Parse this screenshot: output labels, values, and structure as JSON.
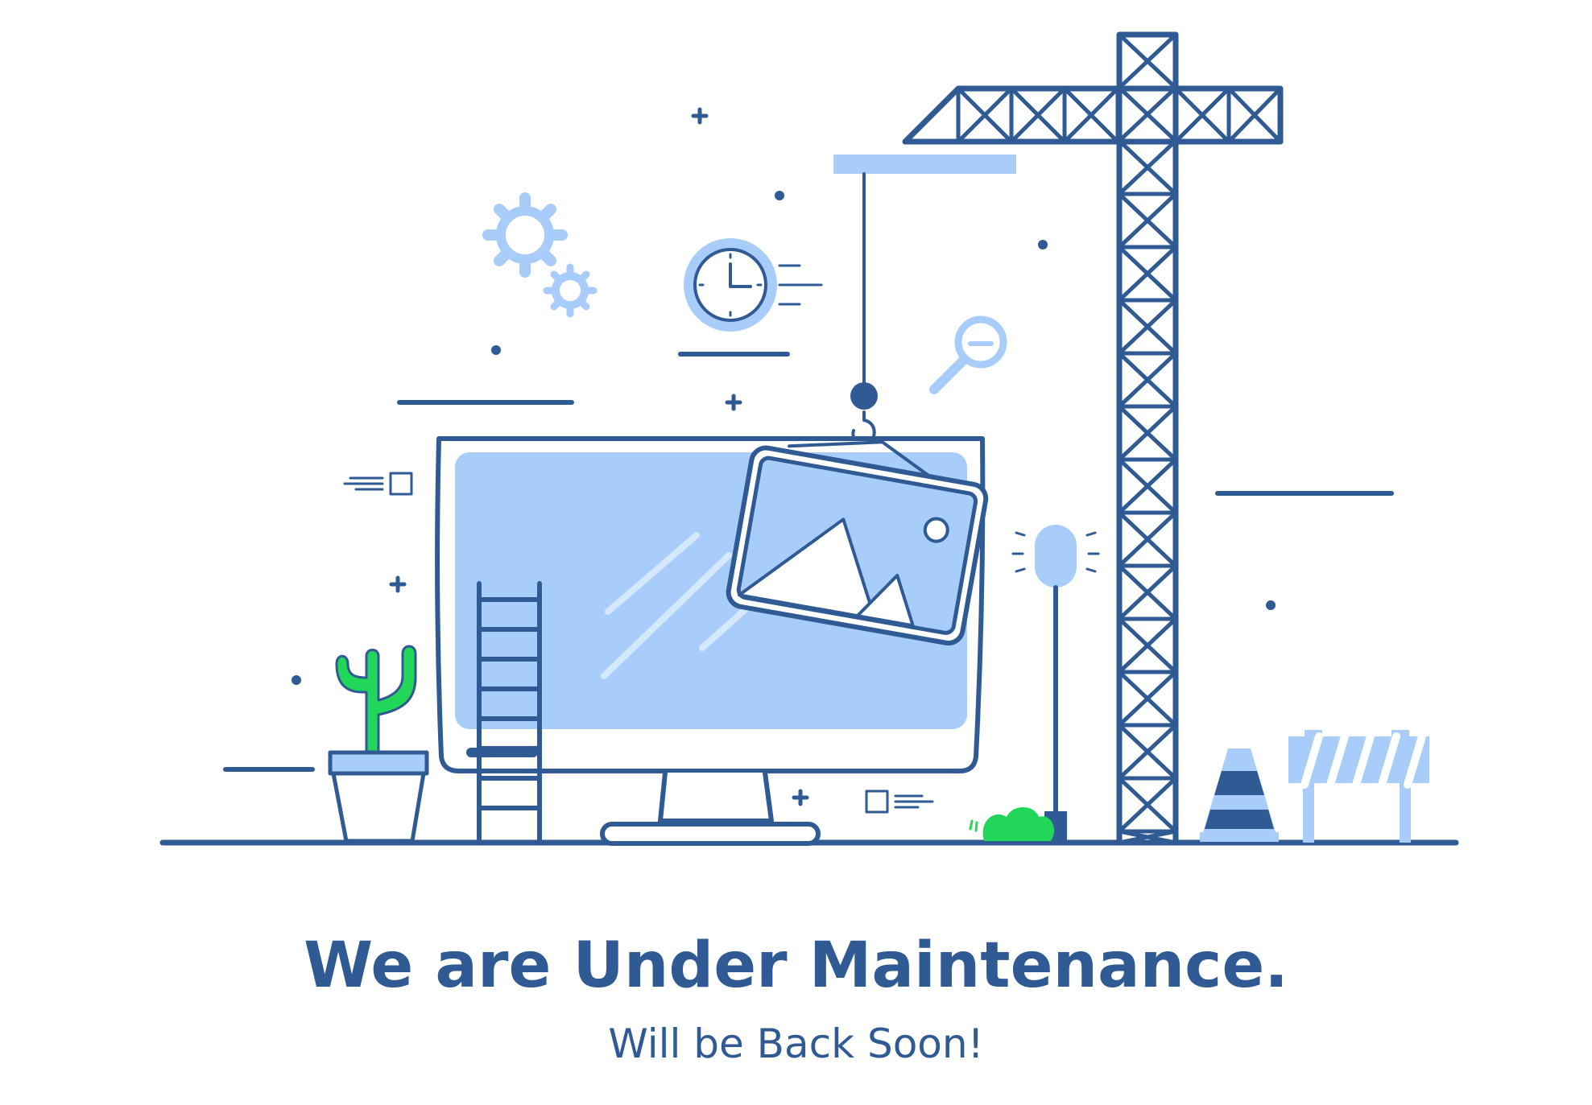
{
  "page": {
    "headline": "We are Under Maintenance.",
    "subline": "Will be Back Soon!"
  },
  "illustration": {
    "icons": [
      "crane-icon",
      "monitor-icon",
      "picture-frame-icon",
      "ladder-icon",
      "cactus-icon",
      "gears-icon",
      "clock-icon",
      "magnifier-icon",
      "lamp-icon",
      "traffic-cone-icon",
      "barrier-icon",
      "bush-icon"
    ]
  },
  "colors": {
    "primary": "#2f5a93",
    "accent_light": "#a9cdfb",
    "cactus_green": "#22d65a",
    "background": "#ffffff"
  }
}
